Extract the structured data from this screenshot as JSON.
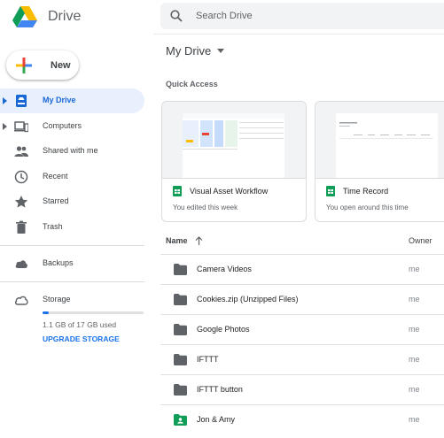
{
  "app": {
    "name": "Drive"
  },
  "new_button": {
    "label": "New"
  },
  "sidebar": {
    "items": [
      {
        "label": "My Drive",
        "icon": "my-drive-icon",
        "active": true,
        "expandable": true
      },
      {
        "label": "Computers",
        "icon": "computers-icon",
        "active": false,
        "expandable": true
      },
      {
        "label": "Shared with me",
        "icon": "people-icon",
        "active": false,
        "expandable": false
      },
      {
        "label": "Recent",
        "icon": "clock-icon",
        "active": false,
        "expandable": false
      },
      {
        "label": "Starred",
        "icon": "star-icon",
        "active": false,
        "expandable": false
      },
      {
        "label": "Trash",
        "icon": "trash-icon",
        "active": false,
        "expandable": false
      }
    ],
    "backups": {
      "label": "Backups",
      "icon": "cloud-icon"
    },
    "storage": {
      "label": "Storage",
      "icon": "cloud-outline-icon",
      "used_text": "1.1 GB of 17 GB used",
      "used_fraction": 0.065,
      "upgrade_label": "UPGRADE STORAGE"
    }
  },
  "search": {
    "placeholder": "Search Drive"
  },
  "main": {
    "title": "My Drive",
    "quick_access": {
      "label": "Quick Access",
      "cards": [
        {
          "name": "Visual Asset Workflow",
          "subtitle": "You edited this week",
          "icon": "sheets-icon"
        },
        {
          "name": "Time Record",
          "subtitle": "You open around this time",
          "icon": "sheets-icon"
        }
      ]
    },
    "list": {
      "headers": {
        "name": "Name",
        "owner": "Owner"
      },
      "rows": [
        {
          "name": "Camera Videos",
          "owner": "me",
          "icon": "folder-icon"
        },
        {
          "name": "Cookies.zip (Unzipped Files)",
          "owner": "me",
          "icon": "folder-icon"
        },
        {
          "name": "Google Photos",
          "owner": "me",
          "icon": "folder-icon"
        },
        {
          "name": "IFTTT",
          "owner": "me",
          "icon": "folder-icon"
        },
        {
          "name": "IFTTT button",
          "owner": "me",
          "icon": "folder-icon"
        },
        {
          "name": "Jon & Amy",
          "owner": "me",
          "icon": "shared-folder-icon"
        }
      ]
    }
  },
  "colors": {
    "accent": "#1a73e8",
    "active_bg": "#e8f0fe",
    "sheets_green": "#0f9d58",
    "folder_gray": "#5f6368"
  }
}
